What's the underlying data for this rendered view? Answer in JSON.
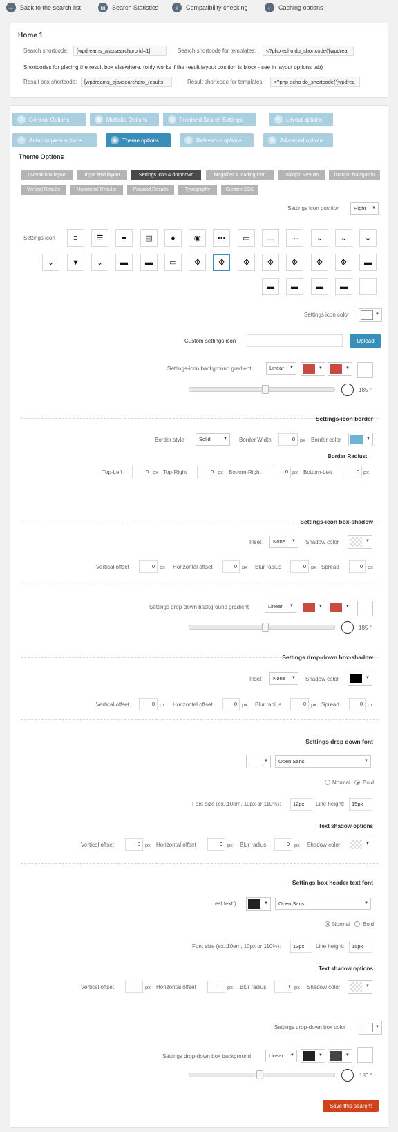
{
  "topnav": [
    {
      "label": "Back to the search list",
      "icon": "back-arrow-icon"
    },
    {
      "label": "Search Statistics",
      "icon": "statistics-icon"
    },
    {
      "label": "Compatibility checking",
      "icon": "info-icon"
    },
    {
      "label": "Caching options",
      "icon": "cache-icon"
    }
  ],
  "info_panel": {
    "title": "Home 1",
    "search_shortcode_label": "Search shortcode:",
    "search_shortcode_value": "[wpdreams_ajaxsearchpro id=1]",
    "template_shortcode_label": "Search shortcode for templates:",
    "template_shortcode_value": "<?php echo do_shortcode('[wpdrea",
    "note": "Shortcodes for placing the result box elsewhere. (only works if the result layout position is block - see in layout options tab)",
    "result_box_label": "Result box shortcode:",
    "result_box_value": "[wpdreams_ajaxsearchpro_results",
    "result_template_label": "Result shortcode for templates:",
    "result_template_value": "<?php echo do_shortcode('[wpdrea"
  },
  "main_tabs": [
    {
      "label": "General Options",
      "active": false
    },
    {
      "label": "Multisite Options",
      "active": false
    },
    {
      "label": "Frontend Search Settings",
      "active": false
    },
    {
      "label": "Layout options",
      "active": false
    },
    {
      "label": "Autocomplete options",
      "active": false
    },
    {
      "label": "Theme options",
      "active": true
    },
    {
      "label": "Relevance options",
      "active": false
    },
    {
      "label": "Advanced options",
      "active": false
    }
  ],
  "section_title": "Theme Options",
  "sub_tabs": [
    {
      "label": "Overall box layout",
      "active": false
    },
    {
      "label": "Input field layout",
      "active": false
    },
    {
      "label": "Settings icon & dropdown",
      "active": true
    },
    {
      "label": "Magnifier & loading icon",
      "active": false
    },
    {
      "label": "Isotopic Results",
      "active": false
    },
    {
      "label": "Isotopic Navigation",
      "active": false
    },
    {
      "label": "Vertical Results",
      "active": false
    },
    {
      "label": "Horizontal Results",
      "active": false
    },
    {
      "label": "Polaroid Results",
      "active": false
    },
    {
      "label": "Typography",
      "active": false
    },
    {
      "label": "Custom CSS",
      "active": false
    }
  ],
  "settings_position": {
    "label": "Settings icon position",
    "value": "Right"
  },
  "settings_icon": {
    "label": "Settings icon",
    "icons": [
      "≡",
      "☰",
      "≣",
      "▤",
      "●",
      "◉",
      "•••",
      "▭",
      "…",
      "⋯",
      "⌄",
      "⌄",
      "⌄",
      "⌄",
      "▼",
      "⌄",
      "▬",
      "▬",
      "▭",
      "⚙",
      "⚙",
      "⚙",
      "⚙",
      "⚙",
      "⚙",
      "⚙",
      "▬",
      "▬",
      "▬",
      "▬",
      "▬"
    ]
  },
  "icon_color": {
    "label": "Settings icon color",
    "color": "#ffffff"
  },
  "custom_icon": {
    "label": "Custom settings icon",
    "value": "",
    "button": "Upload"
  },
  "bg_gradient": {
    "label": "Settings-icon background gradient",
    "type": "Linear",
    "color1": "#c84b43",
    "color2": "#c84b43",
    "color3": "#ffffff",
    "angle": "185 °"
  },
  "border": {
    "header": "Settings-icon border",
    "style_label": "Border style",
    "style_value": "Solid",
    "width_label": "Border Width",
    "width_value": "0",
    "color_label": "Border color",
    "color": "#6bb5d2",
    "radius_label": "Border Radius:",
    "corners": [
      {
        "label": "Top-Left",
        "value": "0"
      },
      {
        "label": "Top-Right",
        "value": "0"
      },
      {
        "label": "Bottom-Right",
        "value": "0"
      },
      {
        "label": "Bottom-Left",
        "value": "0"
      }
    ],
    "unit": "px"
  },
  "icon_shadow": {
    "header": "Settings-icon box-shadow",
    "inset_label": "Inset",
    "inset_value": "None",
    "color_label": "Shadow color",
    "fields": [
      {
        "label": "Vertical offset",
        "value": "0"
      },
      {
        "label": "Horizontal offset",
        "value": "0"
      },
      {
        "label": "Blur radius",
        "value": "0"
      },
      {
        "label": "Spread",
        "value": "0"
      }
    ]
  },
  "dd_gradient": {
    "label": "Settings drop-down background gradient",
    "type": "Linear",
    "color1": "#c84b43",
    "color2": "#c84b43",
    "color3": "#ffffff",
    "angle": "185 °"
  },
  "dd_shadow": {
    "header": "Settings drop-down box-shadow",
    "inset_label": "Inset",
    "inset_value": "None",
    "color_label": "Shadow color",
    "color": "#000000",
    "fields": [
      {
        "label": "Vertical offset",
        "value": "0"
      },
      {
        "label": "Horizontal offset",
        "value": "0"
      },
      {
        "label": "Blur radius",
        "value": "0"
      },
      {
        "label": "Spread",
        "value": "0"
      }
    ]
  },
  "dd_font": {
    "header": "Settings drop down font",
    "font": "Open Sans",
    "normal": "Normal",
    "bold": "Bold",
    "size_label": "Font size (ex.:10em, 10px or 110%):",
    "size_value": "12px",
    "lh_label": "Line height:",
    "lh_value": "15px",
    "shadow_header": "Text shadow options",
    "fields": [
      {
        "label": "Vertical offset",
        "value": "0"
      },
      {
        "label": "Horizontal offset",
        "value": "0"
      },
      {
        "label": "Blur radius",
        "value": "0"
      }
    ],
    "shadow_color_label": "Shadow color"
  },
  "hdr_font": {
    "header": "Settings box header text font",
    "prefix_label": "est text:)",
    "color": "#222222",
    "font": "Open Sans",
    "normal": "Normal",
    "bold": "Bold",
    "size_label": "Font size (ex.:10em, 10px or 110%):",
    "size_value": "13px",
    "lh_label": "Line height:",
    "lh_value": "15px",
    "shadow_header": "Text shadow options",
    "fields": [
      {
        "label": "Vertical offset",
        "value": "0"
      },
      {
        "label": "Horizontal offset",
        "value": "0"
      },
      {
        "label": "Blur radius",
        "value": "0"
      }
    ],
    "shadow_color_label": "Shadow color"
  },
  "dd_box_color": {
    "label": "Settings drop-down box color"
  },
  "dd_bg": {
    "label": "Settings drop-down box background",
    "type": "Linear",
    "color1": "#222222",
    "color2": "#444444",
    "color3": "#ffffff",
    "angle": "180 °"
  },
  "save_button": "Save this search!"
}
